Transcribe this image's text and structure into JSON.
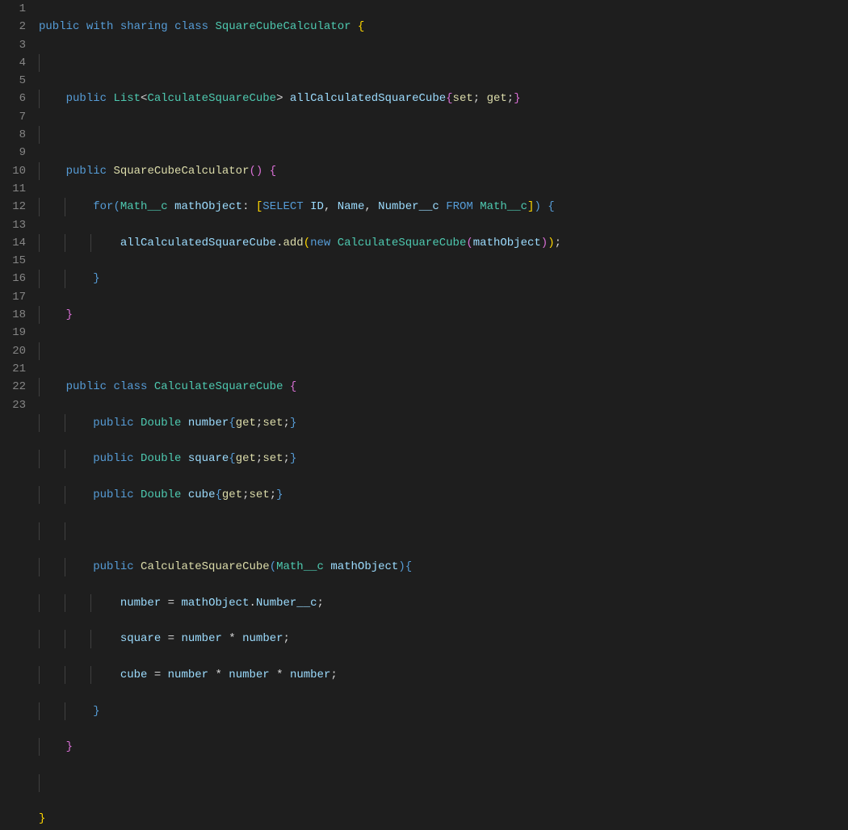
{
  "lineNumbers": [
    "1",
    "2",
    "3",
    "4",
    "5",
    "6",
    "7",
    "8",
    "9",
    "10",
    "11",
    "12",
    "13",
    "14",
    "15",
    "16",
    "17",
    "18",
    "19",
    "20",
    "21",
    "22",
    "23"
  ],
  "code": {
    "l1": {
      "k1": "public",
      "k2": "with",
      "k3": "sharing",
      "k4": "class",
      "t1": "SquareCubeCalculator",
      "b1": "{"
    },
    "l3": {
      "k1": "public",
      "t1": "List",
      "lt": "<",
      "t2": "CalculateSquareCube",
      "gt": ">",
      "v1": "allCalculatedSquareCube",
      "b1": "{",
      "f1": "set",
      "s1": ";",
      "f2": "get",
      "s2": ";",
      "b2": "}"
    },
    "l5": {
      "k1": "public",
      "f1": "SquareCubeCalculator",
      "p1": "()",
      "b1": "{"
    },
    "l6": {
      "k1": "for",
      "p1": "(",
      "t1": "Math__c",
      "v1": "mathObject",
      "c1": ":",
      "br1": "[",
      "q1": "SELECT",
      "f1": "ID",
      "cm1": ",",
      "f2": "Name",
      "cm2": ",",
      "f3": "Number__c",
      "q2": "FROM",
      "t2": "Math__c",
      "br2": "]",
      "p2": ")",
      "b1": "{"
    },
    "l7": {
      "v1": "allCalculatedSquareCube",
      "d1": ".",
      "f1": "add",
      "p1": "(",
      "k1": "new",
      "t1": "CalculateSquareCube",
      "p2": "(",
      "v2": "mathObject",
      "p3": ")",
      "p4": ")",
      "s1": ";"
    },
    "l8": {
      "b1": "}"
    },
    "l9": {
      "b1": "}"
    },
    "l11": {
      "k1": "public",
      "k2": "class",
      "t1": "CalculateSquareCube",
      "b1": "{"
    },
    "l12": {
      "k1": "public",
      "t1": "Double",
      "v1": "number",
      "b1": "{",
      "f1": "get",
      "s1": ";",
      "f2": "set",
      "s2": ";",
      "b2": "}"
    },
    "l13": {
      "k1": "public",
      "t1": "Double",
      "v1": "square",
      "b1": "{",
      "f1": "get",
      "s1": ";",
      "f2": "set",
      "s2": ";",
      "b2": "}"
    },
    "l14": {
      "k1": "public",
      "t1": "Double",
      "v1": "cube",
      "b1": "{",
      "f1": "get",
      "s1": ";",
      "f2": "set",
      "s2": ";",
      "b2": "}"
    },
    "l16": {
      "k1": "public",
      "f1": "CalculateSquareCube",
      "p1": "(",
      "t1": "Math__c",
      "v1": "mathObject",
      "p2": ")",
      "b1": "{"
    },
    "l17": {
      "v1": "number",
      "eq": "=",
      "v2": "mathObject",
      "d1": ".",
      "v3": "Number__c",
      "s1": ";"
    },
    "l18": {
      "v1": "square",
      "eq": "=",
      "v2": "number",
      "op": "*",
      "v3": "number",
      "s1": ";"
    },
    "l19": {
      "v1": "cube",
      "eq": "=",
      "v2": "number",
      "op1": "*",
      "v3": "number",
      "op2": "*",
      "v4": "number",
      "s1": ";"
    },
    "l20": {
      "b1": "}"
    },
    "l21": {
      "b1": "}"
    },
    "l23": {
      "b1": "}"
    }
  }
}
